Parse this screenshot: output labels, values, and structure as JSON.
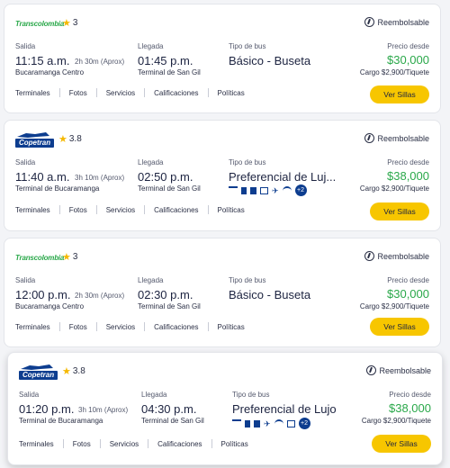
{
  "cards": [
    {
      "company": "Transcolombia",
      "rating": "3",
      "refund": "Reembolsable",
      "depart_label": "Salida",
      "depart_time": "11:15 a.m.",
      "duration": "2h 30m (Aprox)",
      "depart_place": "Bucaramanga Centro",
      "arrive_label": "Llegada",
      "arrive_time": "01:45 p.m.",
      "arrive_place": "Terminal de San Gil",
      "bus_label": "Tipo de bus",
      "bus_type": "Básico - Buseta",
      "price_label": "Precio desde",
      "price": "$30,000",
      "fee": "Cargo $2,900/Tiquete",
      "links": [
        "Terminales",
        "Fotos",
        "Servicios",
        "Calificaciones",
        "Políticas"
      ],
      "button": "Ver Sillas"
    },
    {
      "company": "Copetran",
      "rating": "3.8",
      "refund": "Reembolsable",
      "depart_label": "Salida",
      "depart_time": "11:40 a.m.",
      "duration": "3h 10m (Aprox)",
      "depart_place": "Terminal de Bucaramanga",
      "arrive_label": "Llegada",
      "arrive_time": "02:50 p.m.",
      "arrive_place": "Terminal de San Gil",
      "bus_label": "Tipo de bus",
      "bus_type": "Preferencial de Luj...",
      "amenities_more": "+2",
      "price_label": "Precio desde",
      "price": "$38,000",
      "fee": "Cargo $2,900/Tiquete",
      "links": [
        "Terminales",
        "Fotos",
        "Servicios",
        "Calificaciones",
        "Políticas"
      ],
      "button": "Ver Sillas"
    },
    {
      "company": "Transcolombia",
      "rating": "3",
      "refund": "Reembolsable",
      "depart_label": "Salida",
      "depart_time": "12:00 p.m.",
      "duration": "2h 30m (Aprox)",
      "depart_place": "Bucaramanga Centro",
      "arrive_label": "Llegada",
      "arrive_time": "02:30 p.m.",
      "arrive_place": "Terminal de San Gil",
      "bus_label": "Tipo de bus",
      "bus_type": "Básico - Buseta",
      "price_label": "Precio desde",
      "price": "$30,000",
      "fee": "Cargo $2,900/Tiquete",
      "links": [
        "Terminales",
        "Fotos",
        "Servicios",
        "Calificaciones",
        "Políticas"
      ],
      "button": "Ver Sillas"
    },
    {
      "company": "Copetran",
      "rating": "3.8",
      "refund": "Reembolsable",
      "depart_label": "Salida",
      "depart_time": "01:20 p.m.",
      "duration": "3h 10m (Aprox)",
      "depart_place": "Terminal de Bucaramanga",
      "arrive_label": "Llegada",
      "arrive_time": "04:30 p.m.",
      "arrive_place": "Terminal de San Gil",
      "bus_label": "Tipo de bus",
      "bus_type": "Preferencial de Lujo",
      "amenities_more": "+2",
      "price_label": "Precio desde",
      "price": "$38,000",
      "fee": "Cargo $2,900/Tiquete",
      "links": [
        "Terminales",
        "Fotos",
        "Servicios",
        "Calificaciones",
        "Políticas"
      ],
      "button": "Ver Sillas"
    }
  ],
  "colors": {
    "accent_yellow": "#f7c600",
    "price_green": "#2aa84a",
    "brand_blue": "#0d3d8f"
  }
}
